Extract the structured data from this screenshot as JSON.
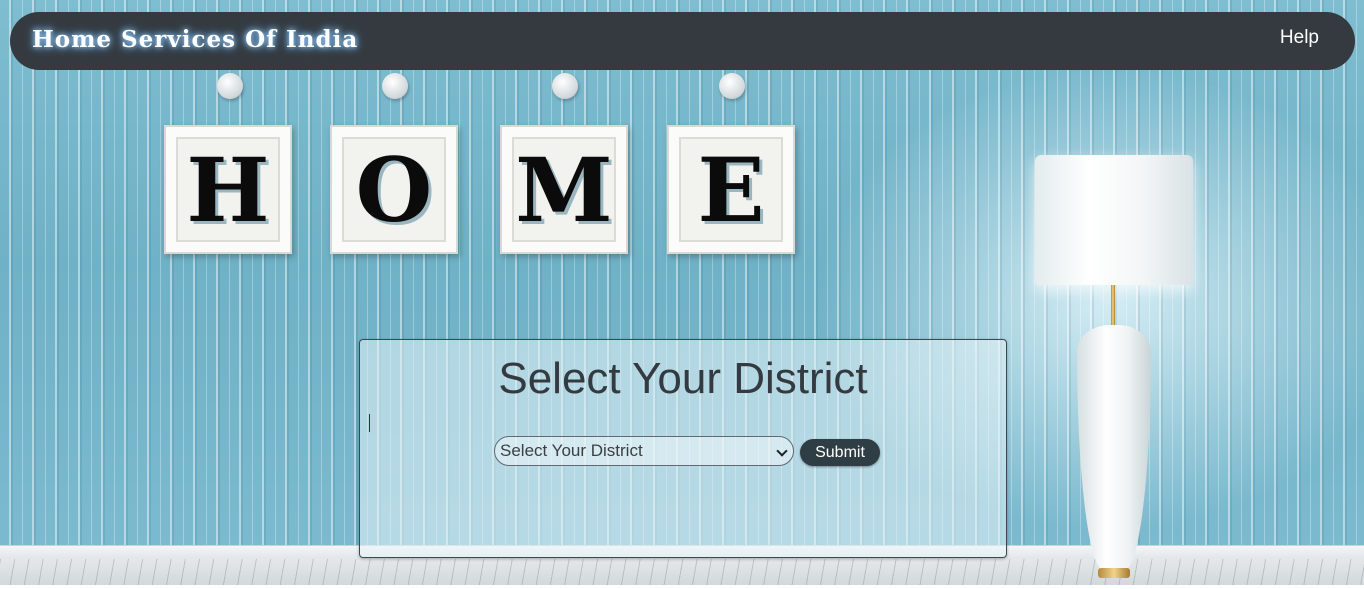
{
  "navbar": {
    "brand": "Home Services Of India",
    "help_label": "Help"
  },
  "decor": {
    "frames": [
      "H",
      "O",
      "M",
      "E"
    ]
  },
  "form": {
    "title": "Select Your District",
    "district_select": {
      "selected": "Select Your District"
    },
    "submit_label": "Submit"
  },
  "colors": {
    "navbar_bg": "#343a40",
    "wall": "#7fbdd0",
    "submit_bg": "#2f3e44"
  }
}
